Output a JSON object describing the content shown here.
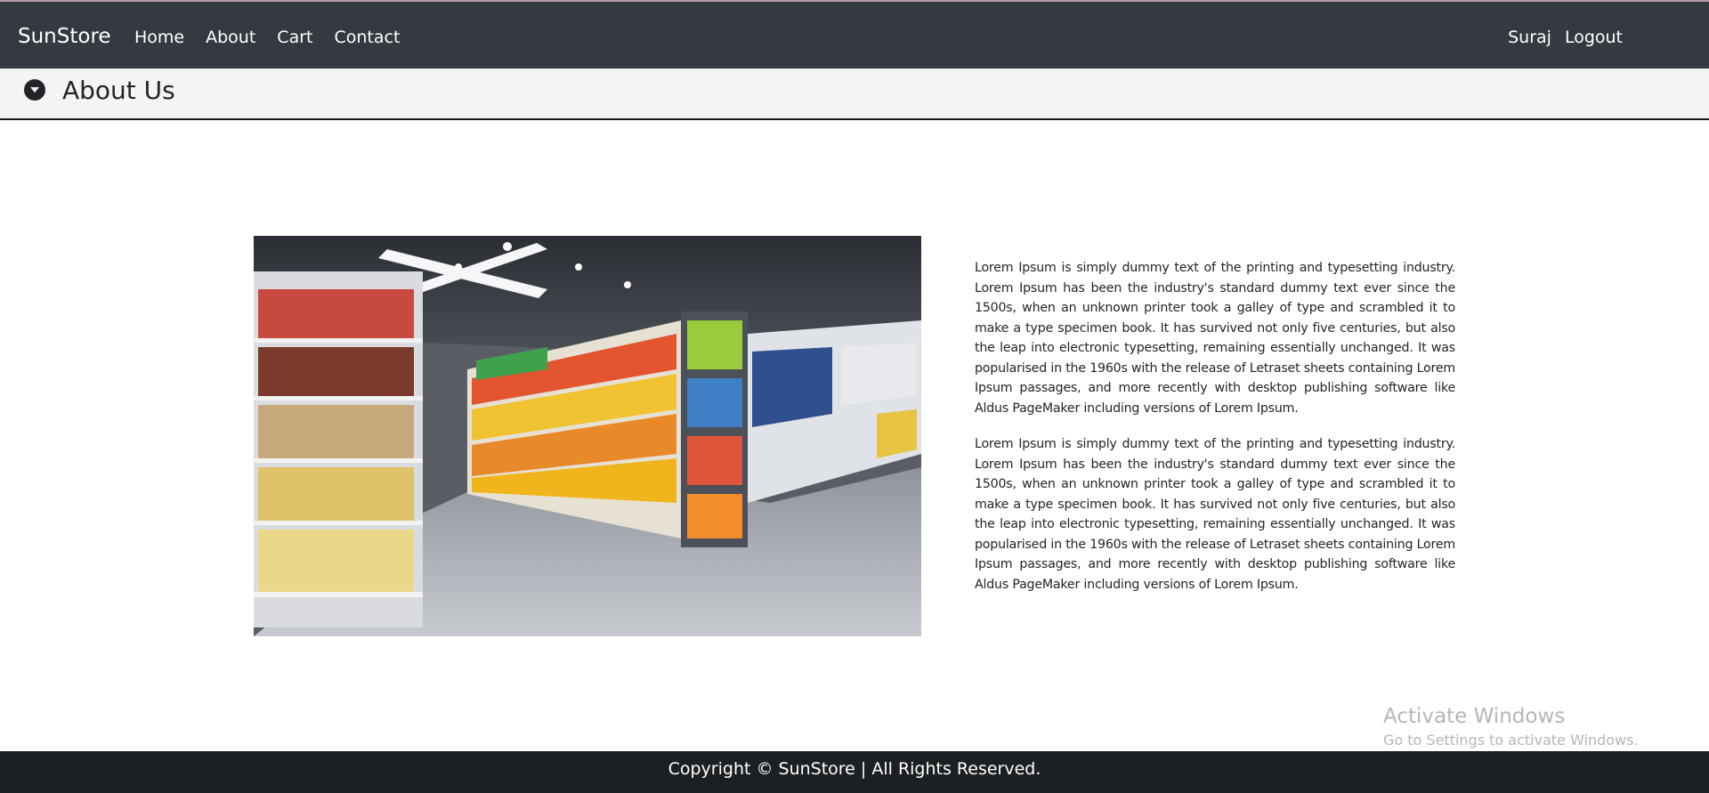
{
  "navbar": {
    "brand": "SunStore",
    "links": [
      "Home",
      "About",
      "Cart",
      "Contact"
    ],
    "user": "Suraj",
    "logout": "Logout",
    "bg_color": "#343a40"
  },
  "about_bar": {
    "toggle_icon": "caret-down-circle-icon",
    "title": "About Us"
  },
  "content": {
    "image_subject": "supermarket aisle with snack shelves",
    "paragraphs": [
      "Lorem Ipsum is simply dummy text of the printing and typesetting industry. Lorem Ipsum has been the industry's standard dummy text ever since the 1500s, when an unknown printer took a galley of type and scrambled it to make a type specimen book. It has survived not only five centuries, but also the leap into electronic typesetting, remaining essentially unchanged. It was popularised in the 1960s with the release of Letraset sheets containing Lorem Ipsum passages, and more recently with desktop publishing software like Aldus PageMaker including versions of Lorem Ipsum.",
      "Lorem Ipsum is simply dummy text of the printing and typesetting industry. Lorem Ipsum has been the industry's standard dummy text ever since the 1500s, when an unknown printer took a galley of type and scrambled it to make a type specimen book. It has survived not only five centuries, but also the leap into electronic typesetting, remaining essentially unchanged. It was popularised in the 1960s with the release of Letraset sheets containing Lorem Ipsum passages, and more recently with desktop publishing software like Aldus PageMaker including versions of Lorem Ipsum."
    ]
  },
  "watermark": {
    "title": "Activate Windows",
    "subtitle": "Go to Settings to activate Windows."
  },
  "footer": {
    "text": "Copyright © SunStore | All Rights Reserved.",
    "bg_color": "#1d2023"
  }
}
